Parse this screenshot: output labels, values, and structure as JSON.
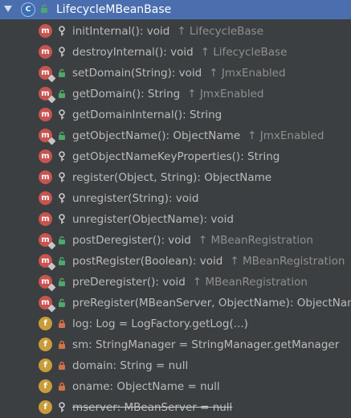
{
  "tree": {
    "class_node": {
      "name": "LifecycleMBeanBase",
      "icon": "class-icon",
      "access": "public"
    },
    "members": [
      {
        "kind": "m",
        "access": "protected",
        "text": "initInternal(): void",
        "inherited": "↑ LifecycleBase",
        "override": false
      },
      {
        "kind": "m",
        "access": "protected",
        "text": "destroyInternal(): void",
        "inherited": "↑ LifecycleBase",
        "override": false
      },
      {
        "kind": "m",
        "access": "public",
        "text": "setDomain(String): void",
        "inherited": "↑ JmxEnabled",
        "override": true
      },
      {
        "kind": "m",
        "access": "public",
        "text": "getDomain(): String",
        "inherited": "↑ JmxEnabled",
        "override": true
      },
      {
        "kind": "m",
        "access": "protected",
        "text": "getDomainInternal(): String",
        "inherited": "",
        "override": false
      },
      {
        "kind": "m",
        "access": "public",
        "text": "getObjectName(): ObjectName",
        "inherited": "↑ JmxEnabled",
        "override": true
      },
      {
        "kind": "m",
        "access": "protected",
        "text": "getObjectNameKeyProperties(): String",
        "inherited": "",
        "override": false
      },
      {
        "kind": "m",
        "access": "protected",
        "text": "register(Object, String): ObjectName",
        "inherited": "",
        "override": false
      },
      {
        "kind": "m",
        "access": "protected",
        "text": "unregister(String): void",
        "inherited": "",
        "override": false
      },
      {
        "kind": "m",
        "access": "protected",
        "text": "unregister(ObjectName): void",
        "inherited": "",
        "override": false
      },
      {
        "kind": "m",
        "access": "public",
        "text": "postDeregister(): void",
        "inherited": "↑ MBeanRegistration",
        "override": true
      },
      {
        "kind": "m",
        "access": "public",
        "text": "postRegister(Boolean): void",
        "inherited": "↑ MBeanRegistration",
        "override": true
      },
      {
        "kind": "m",
        "access": "public",
        "text": "preDeregister(): void",
        "inherited": "↑ MBeanRegistration",
        "override": true
      },
      {
        "kind": "m",
        "access": "public",
        "text": "preRegister(MBeanServer, ObjectName): ObjectName",
        "inherited": "",
        "override": true
      },
      {
        "kind": "f",
        "access": "private",
        "text": "log: Log = LogFactory.getLog(...)",
        "inherited": "",
        "override": false
      },
      {
        "kind": "f",
        "access": "private",
        "text": "sm: StringManager = StringManager.getManager",
        "inherited": "",
        "override": false
      },
      {
        "kind": "f",
        "access": "private",
        "text": "domain: String = null",
        "inherited": "",
        "override": false
      },
      {
        "kind": "f",
        "access": "private",
        "text": "oname: ObjectName = null",
        "inherited": "",
        "override": false
      },
      {
        "kind": "f",
        "access": "protected",
        "text": "mserver: MBeanServer = null",
        "inherited": "",
        "override": false,
        "deprecated": true
      }
    ]
  },
  "colors": {
    "background": "#3c3f41",
    "selection": "#4b6eaf",
    "text": "#bbbbbb",
    "inherited_text": "#8f8f8f",
    "method_badge": "#c75450",
    "field_badge": "#c99c3b",
    "public_lock": "#4fa86b",
    "private_lock": "#d0734a",
    "protected_key": "#c9c9c9"
  }
}
